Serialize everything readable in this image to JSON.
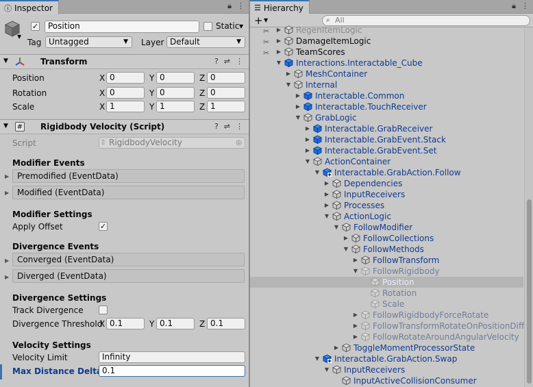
{
  "inspector": {
    "tab_label": "Inspector",
    "object_name": "Position",
    "static_label": "Static",
    "tag_label": "Tag",
    "tag_value": "Untagged",
    "layer_label": "Layer",
    "layer_value": "Default",
    "transform": {
      "title": "Transform",
      "position_label": "Position",
      "rotation_label": "Rotation",
      "scale_label": "Scale",
      "position": {
        "x": "0",
        "y": "0",
        "z": "0"
      },
      "rotation": {
        "x": "0",
        "y": "0",
        "z": "0"
      },
      "scale": {
        "x": "1",
        "y": "1",
        "z": "1"
      },
      "axis_x": "X",
      "axis_y": "Y",
      "axis_z": "Z"
    },
    "rigidbody": {
      "title": "Rigidbody Velocity (Script)",
      "script_label": "Script",
      "script_value": "RigidbodyVelocity",
      "modifier_events_header": "Modifier Events",
      "premodified": "Premodified (EventData)",
      "modified": "Modified (EventData)",
      "modifier_settings_header": "Modifier Settings",
      "apply_offset_label": "Apply Offset",
      "divergence_events_header": "Divergence Events",
      "converged": "Converged (EventData)",
      "diverged": "Diverged (EventData)",
      "divergence_settings_header": "Divergence Settings",
      "track_divergence_label": "Track Divergence",
      "divergence_threshold_label": "Divergence Threshold",
      "threshold": {
        "x": "0.1",
        "y": "0.1",
        "z": "0.1"
      },
      "velocity_settings_header": "Velocity Settings",
      "velocity_limit_label": "Velocity Limit",
      "velocity_limit_value": "Infinity",
      "max_distance_label": "Max Distance Delta",
      "max_distance_value": "0.1"
    }
  },
  "hierarchy": {
    "tab_label": "Hierarchy",
    "search_placeholder": "All",
    "items": [
      {
        "label": "RegenItemLogic",
        "depth": 0,
        "arrow": "right",
        "style": "faded",
        "icon": "gray"
      },
      {
        "label": "DamageItemLogic",
        "depth": 0,
        "arrow": "right",
        "style": "normal",
        "icon": "gray"
      },
      {
        "label": "TeamScores",
        "depth": 0,
        "arrow": "right",
        "style": "normal",
        "icon": "gray"
      },
      {
        "label": "Interactions.Interactable_Cube",
        "depth": 0,
        "arrow": "down",
        "style": "blue",
        "icon": "blue"
      },
      {
        "label": "MeshContainer",
        "depth": 1,
        "arrow": "right",
        "style": "blue",
        "icon": "gray"
      },
      {
        "label": "Internal",
        "depth": 1,
        "arrow": "down",
        "style": "blue",
        "icon": "gray"
      },
      {
        "label": "Interactable.Common",
        "depth": 2,
        "arrow": "right",
        "style": "blue",
        "icon": "blue"
      },
      {
        "label": "Interactable.TouchReceiver",
        "depth": 2,
        "arrow": "right",
        "style": "blue",
        "icon": "blue"
      },
      {
        "label": "GrabLogic",
        "depth": 2,
        "arrow": "down",
        "style": "blue",
        "icon": "gray"
      },
      {
        "label": "Interactable.GrabReceiver",
        "depth": 3,
        "arrow": "right",
        "style": "blue",
        "icon": "blue"
      },
      {
        "label": "Interactable.GrabEvent.Stack",
        "depth": 3,
        "arrow": "right",
        "style": "blue",
        "icon": "blue"
      },
      {
        "label": "Interactable.GrabEvent.Set",
        "depth": 3,
        "arrow": "right",
        "style": "blue",
        "icon": "blue"
      },
      {
        "label": "ActionContainer",
        "depth": 3,
        "arrow": "down",
        "style": "blue",
        "icon": "gray"
      },
      {
        "label": "Interactable.GrabAction.Follow",
        "depth": 4,
        "arrow": "down",
        "style": "blue",
        "icon": "blueplus"
      },
      {
        "label": "Dependencies",
        "depth": 5,
        "arrow": "right",
        "style": "blue",
        "icon": "gray"
      },
      {
        "label": "InputReceivers",
        "depth": 5,
        "arrow": "right",
        "style": "blue",
        "icon": "gray"
      },
      {
        "label": "Processes",
        "depth": 5,
        "arrow": "right",
        "style": "blue",
        "icon": "gray"
      },
      {
        "label": "ActionLogic",
        "depth": 5,
        "arrow": "down",
        "style": "blue",
        "icon": "gray"
      },
      {
        "label": "FollowModifier",
        "depth": 6,
        "arrow": "down",
        "style": "blue",
        "icon": "gray"
      },
      {
        "label": "FollowCollections",
        "depth": 7,
        "arrow": "right",
        "style": "blue",
        "icon": "gray"
      },
      {
        "label": "FollowMethods",
        "depth": 7,
        "arrow": "down",
        "style": "blue",
        "icon": "gray"
      },
      {
        "label": "FollowTransform",
        "depth": 8,
        "arrow": "right",
        "style": "blue",
        "icon": "gray"
      },
      {
        "label": "FollowRigidbody",
        "depth": 8,
        "arrow": "down",
        "style": "dim",
        "icon": "faded"
      },
      {
        "label": "Position",
        "depth": 9,
        "arrow": "",
        "style": "selected",
        "icon": "faded"
      },
      {
        "label": "Rotation",
        "depth": 9,
        "arrow": "",
        "style": "dim",
        "icon": "faded"
      },
      {
        "label": "Scale",
        "depth": 9,
        "arrow": "",
        "style": "dim",
        "icon": "faded"
      },
      {
        "label": "FollowRigidbodyForceRotate",
        "depth": 8,
        "arrow": "right",
        "style": "dim",
        "icon": "faded"
      },
      {
        "label": "FollowTransformRotateOnPositionDifference",
        "depth": 8,
        "arrow": "right",
        "style": "dim",
        "icon": "faded"
      },
      {
        "label": "FollowRotateAroundAngularVelocity",
        "depth": 8,
        "arrow": "right",
        "style": "dim",
        "icon": "faded"
      },
      {
        "label": "ToggleMomentProcessorState",
        "depth": 6,
        "arrow": "right",
        "style": "blue",
        "icon": "gray"
      },
      {
        "label": "Interactable.GrabAction.Swap",
        "depth": 4,
        "arrow": "down",
        "style": "blue",
        "icon": "blueplus"
      },
      {
        "label": "InputReceivers",
        "depth": 5,
        "arrow": "down",
        "style": "blue",
        "icon": "gray"
      },
      {
        "label": "InputActiveCollisionConsumer",
        "depth": 6,
        "arrow": "",
        "style": "blue",
        "icon": "gray"
      }
    ]
  },
  "colors": {
    "accent": "#3a72b0",
    "prefab_blue": "#0f3a8e",
    "cube_blue": "#1e6fd6",
    "selected_row": "#b5b5b5"
  }
}
